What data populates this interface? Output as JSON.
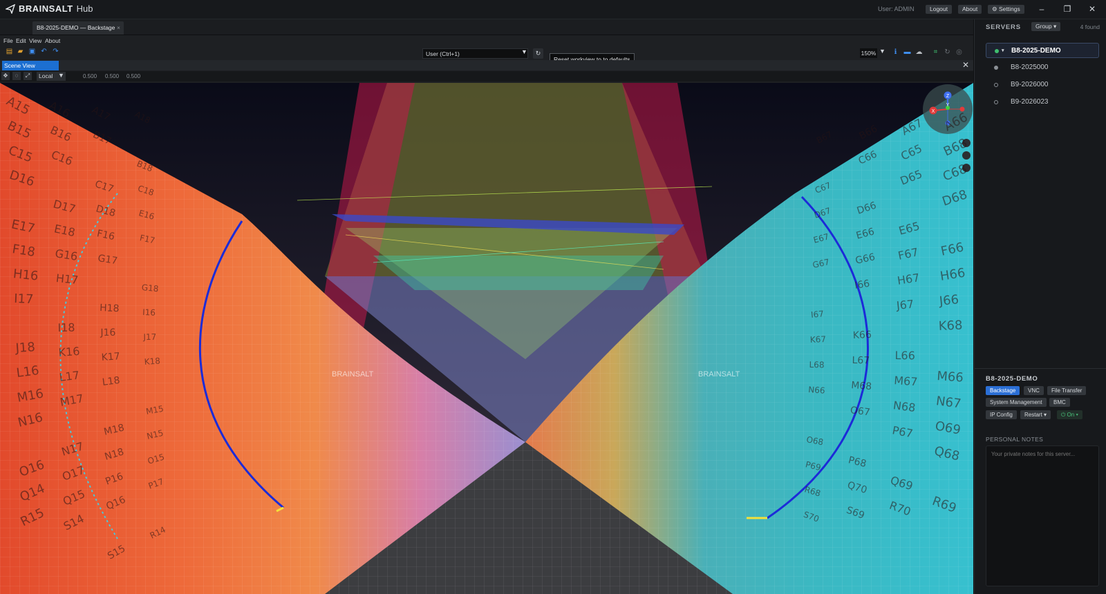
{
  "header": {
    "brand": "BRAINSALT",
    "product": "Hub",
    "user_label": "User: ADMIN",
    "buttons": {
      "logout": "Logout",
      "about": "About",
      "settings": "⚙ Settings"
    }
  },
  "tabs": {
    "active_label": "B8-2025-DEMO — Backstage",
    "close": "×"
  },
  "menu": [
    "File",
    "Edit",
    "View",
    "About"
  ],
  "toolbar": {
    "workspace_value": "User  (Ctrl+1)",
    "tooltip": "Reset workview to to defaults",
    "zoom": "150%"
  },
  "scene": {
    "tab_label": "Scene View",
    "space": "Local",
    "values": [
      "0.500",
      "0.500",
      "0.500"
    ],
    "gizmo_axes": {
      "z": "Z",
      "y": "Y",
      "x": "X"
    },
    "logo_text_left": "BRAINSALT",
    "logo_text_right": "BRAINSALT"
  },
  "servers": {
    "title": "SERVERS",
    "group_label": "Group ▾",
    "found": "4 found",
    "items": [
      {
        "name": "B8-2025-DEMO",
        "status": "online",
        "selected": true
      },
      {
        "name": "B8-2025000",
        "status": "idle",
        "selected": false
      },
      {
        "name": "B9-2026000",
        "status": "offline",
        "selected": false
      },
      {
        "name": "B9-2026023",
        "status": "offline",
        "selected": false
      }
    ]
  },
  "details": {
    "title": "B8-2025-DEMO",
    "actions": {
      "backstage": "Backstage",
      "vnc": "VNC",
      "file_transfer": "File Transfer",
      "system_management": "System Management",
      "bmc": "BMC",
      "ip_config": "IP Config",
      "restart": "Restart ▾",
      "power": "⏻ On ▾"
    },
    "notes_title": "PERSONAL NOTES",
    "notes_placeholder": "Your private notes for this server..."
  },
  "colors": {
    "accent": "#1c6fd1",
    "online": "#3fbf6f",
    "panel_bg": "#17191c",
    "left_wall": "#e8452a",
    "right_wall": "#2fb7c9"
  },
  "wall_labels": {
    "left": [
      "A15",
      "A16",
      "A17",
      "A18",
      "B15",
      "B16",
      "B17",
      "B18",
      "C15",
      "C16",
      "C17",
      "C18",
      "D16",
      "D17",
      "D18",
      "E16",
      "E17",
      "E18",
      "F16",
      "F17",
      "F18",
      "G16",
      "G17",
      "G18",
      "H16",
      "H17",
      "H18",
      "I16",
      "I17",
      "I18",
      "J16",
      "J17",
      "J18",
      "K16",
      "K17",
      "K18",
      "L16",
      "L17",
      "L18",
      "M15",
      "M16",
      "M17",
      "M18",
      "N15",
      "N16",
      "N17",
      "N18",
      "O15",
      "O16",
      "O17",
      "P16",
      "P17",
      "Q14",
      "Q15",
      "Q16",
      "R14",
      "R15",
      "S14",
      "S15"
    ],
    "right": [
      "A66",
      "A67",
      "B66",
      "B67",
      "B68",
      "C65",
      "C66",
      "C67",
      "C68",
      "D65",
      "D66",
      "D67",
      "D68",
      "E65",
      "E66",
      "E67",
      "F66",
      "F67",
      "G66",
      "G67",
      "H66",
      "H67",
      "I66",
      "I67",
      "J66",
      "J67",
      "K66",
      "K67",
      "K68",
      "L66",
      "L67",
      "L68",
      "M66",
      "M67",
      "M68",
      "N66",
      "N67",
      "N68",
      "O67",
      "O68",
      "O69",
      "P67",
      "P68",
      "P69",
      "Q68",
      "Q69",
      "Q70",
      "R68",
      "R69",
      "R70",
      "S69",
      "S70"
    ]
  }
}
